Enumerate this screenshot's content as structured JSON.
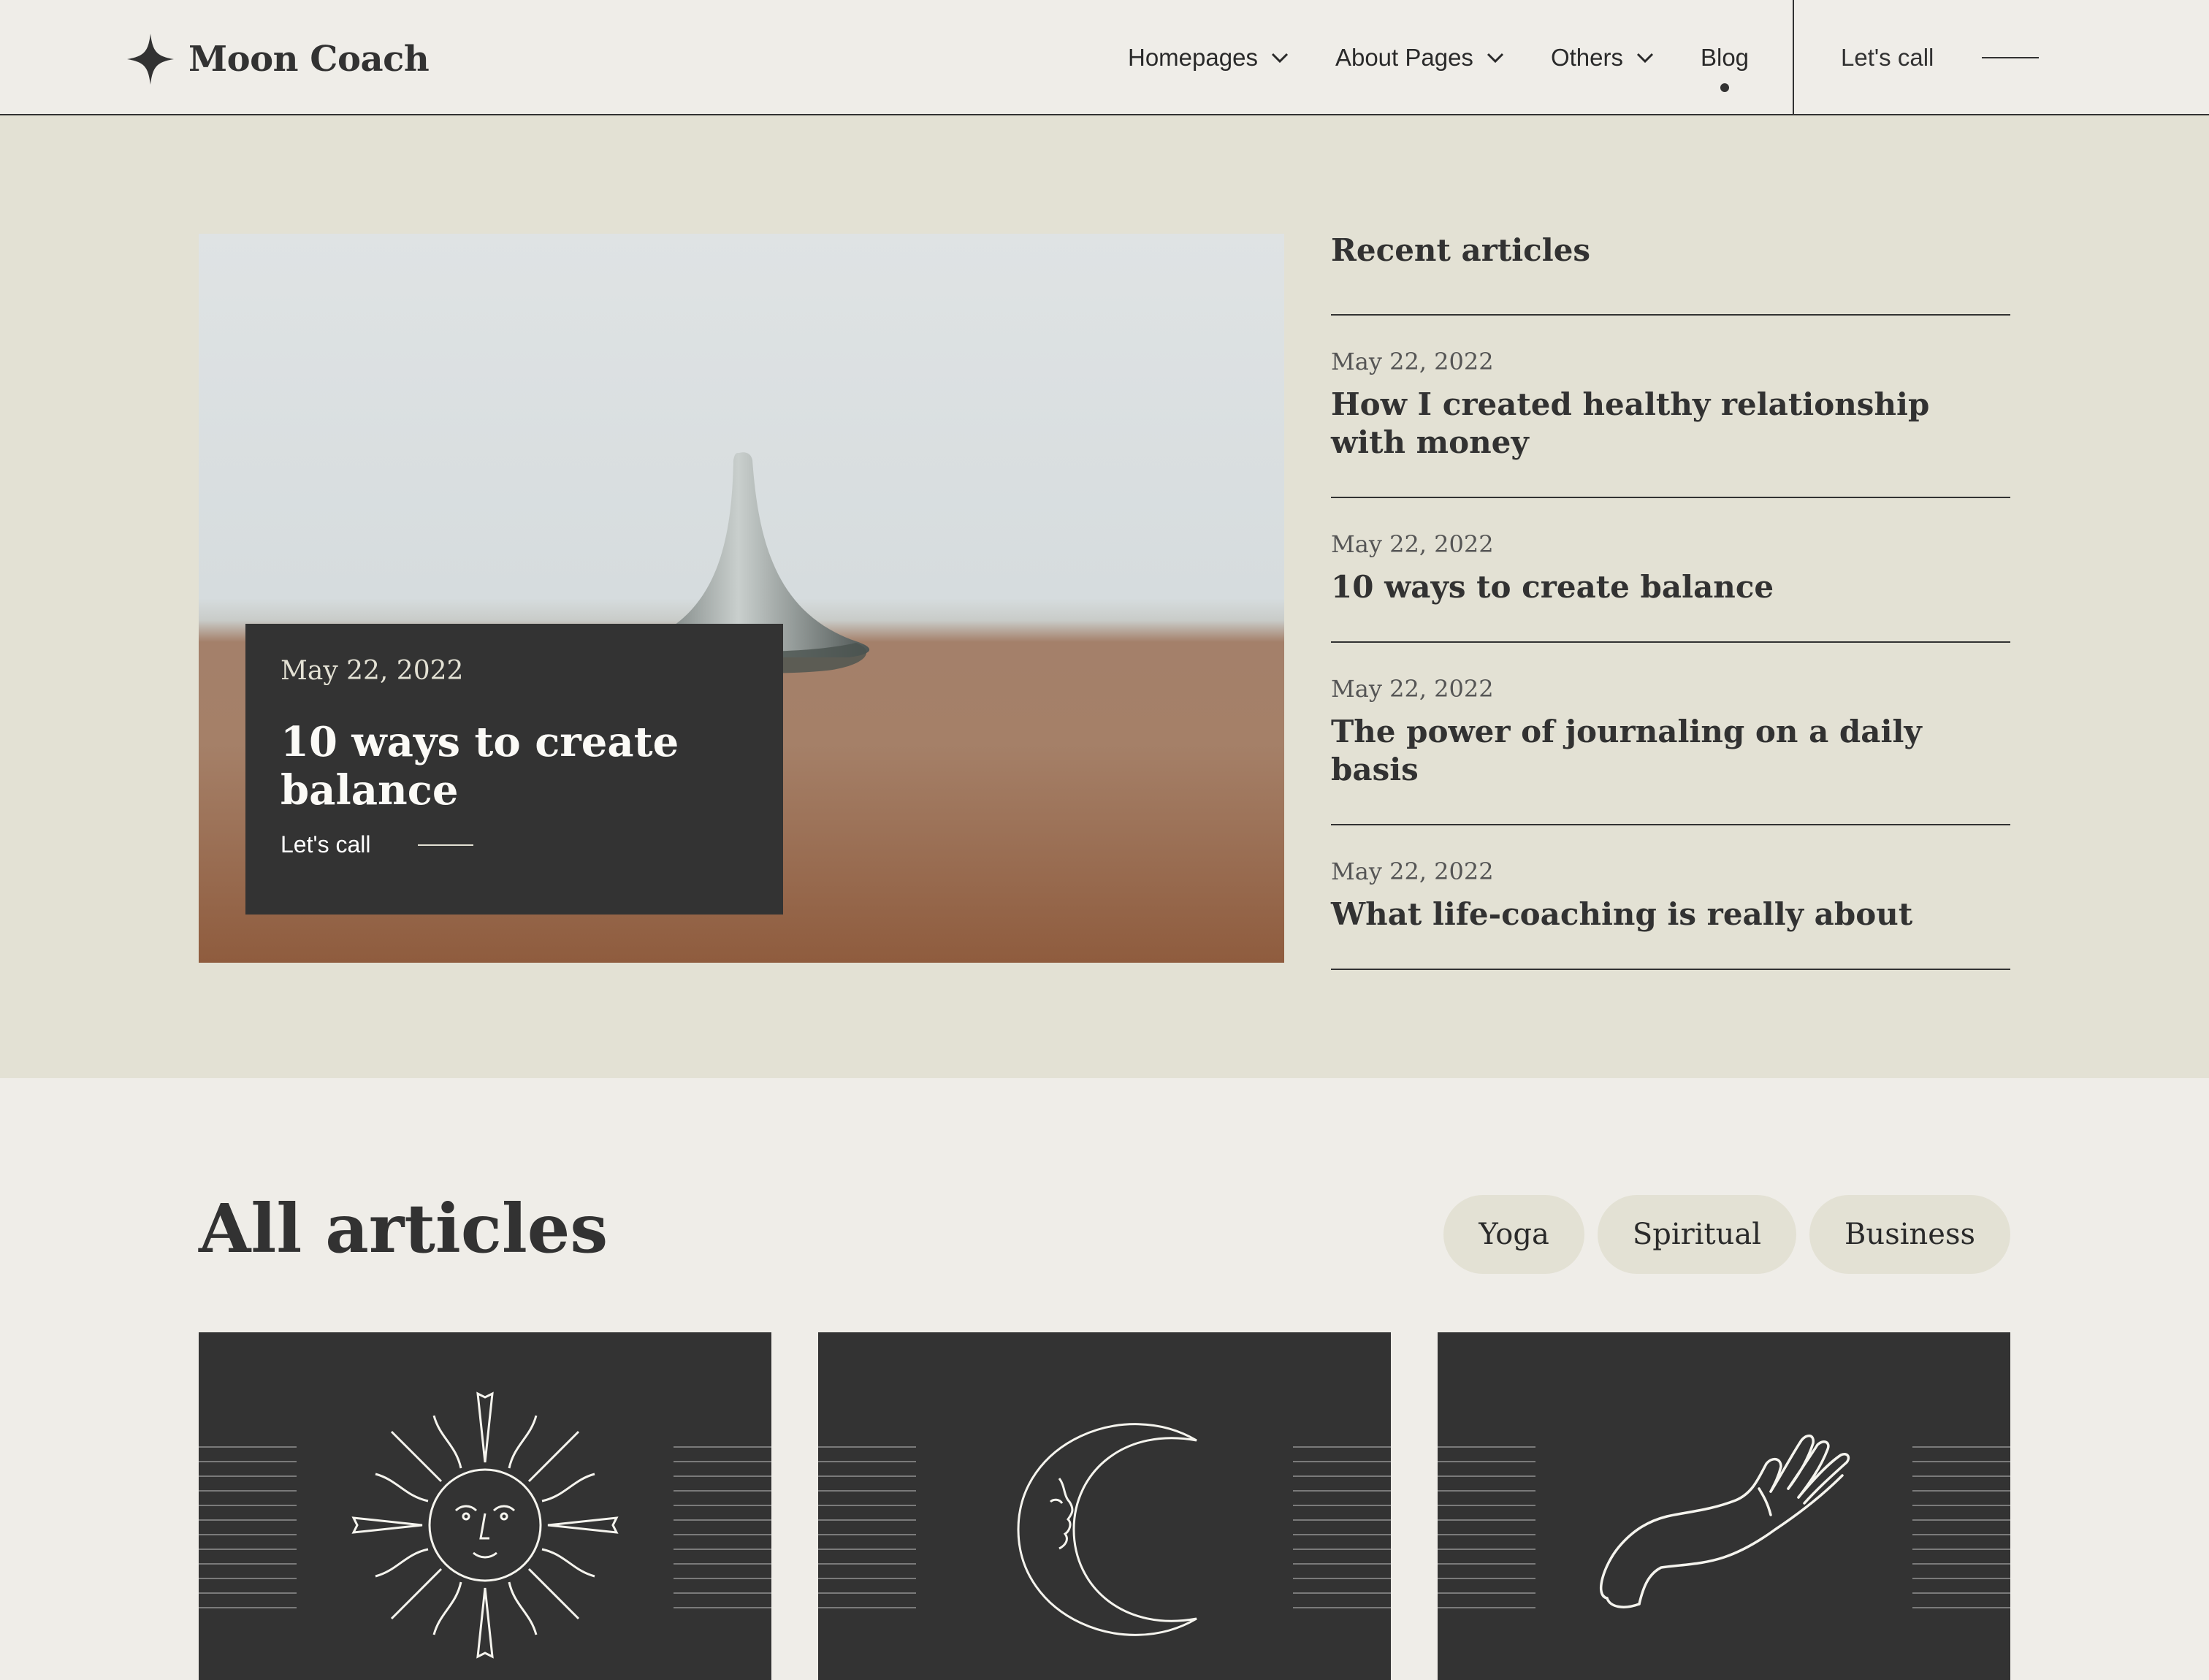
{
  "brand": {
    "name": "Moon Coach",
    "logo_icon": "four-point-star-icon"
  },
  "nav": {
    "items": [
      {
        "label": "Homepages",
        "has_dropdown": true
      },
      {
        "label": "About Pages",
        "has_dropdown": true
      },
      {
        "label": "Others",
        "has_dropdown": true
      },
      {
        "label": "Blog",
        "has_dropdown": false,
        "active": true
      }
    ],
    "cta_label": "Let's call"
  },
  "hero": {
    "featured": {
      "date": "May 22, 2022",
      "title": "10 ways to create balance",
      "cta_label": "Let's call"
    }
  },
  "recent": {
    "heading": "Recent articles",
    "items": [
      {
        "date": "May 22, 2022",
        "title": "How I created healthy relationship with money"
      },
      {
        "date": "May 22, 2022",
        "title": "10 ways to create balance"
      },
      {
        "date": "May 22, 2022",
        "title": "The power of journaling on a daily basis"
      },
      {
        "date": "May 22, 2022",
        "title": "What life-coaching is really about"
      }
    ]
  },
  "all_articles": {
    "heading": "All articles",
    "filters": [
      "Yoga",
      "Spiritual",
      "Business"
    ],
    "cards": [
      {
        "icon": "sun-face-icon"
      },
      {
        "icon": "crescent-moon-face-icon"
      },
      {
        "icon": "hand-icon"
      }
    ]
  },
  "colors": {
    "background": "#efede8",
    "hero_band": "#e3e1d4",
    "dark": "#333333",
    "text": "#323232"
  }
}
